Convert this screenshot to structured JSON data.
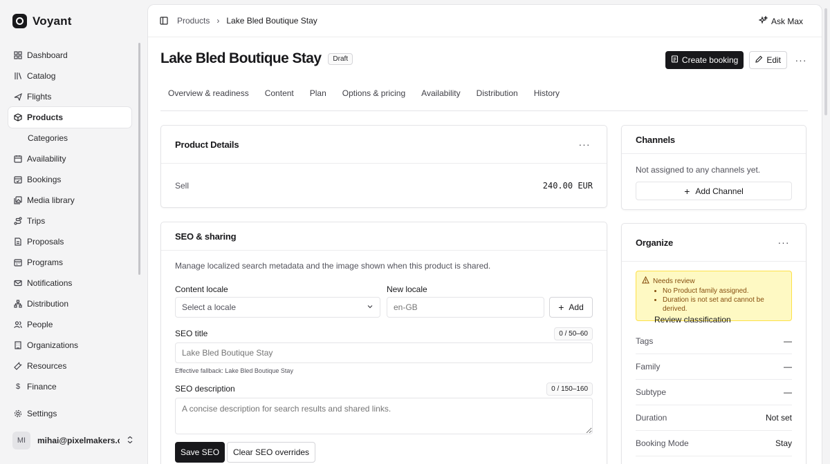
{
  "app": {
    "name": "Voyant"
  },
  "sidebar": {
    "items": [
      {
        "label": "Dashboard",
        "icon": "dashboard-icon"
      },
      {
        "label": "Catalog",
        "icon": "library-icon"
      },
      {
        "label": "Flights",
        "icon": "plane-icon"
      },
      {
        "label": "Products",
        "icon": "package-icon",
        "active": true
      },
      {
        "label": "Categories",
        "icon": "",
        "sub": true
      },
      {
        "label": "Availability",
        "icon": "calendar-icon"
      },
      {
        "label": "Bookings",
        "icon": "calendar-check-icon"
      },
      {
        "label": "Media library",
        "icon": "images-icon"
      },
      {
        "label": "Trips",
        "icon": "route-icon"
      },
      {
        "label": "Proposals",
        "icon": "file-icon"
      },
      {
        "label": "Programs",
        "icon": "calendar-grid-icon"
      },
      {
        "label": "Notifications",
        "icon": "mail-icon"
      },
      {
        "label": "Distribution",
        "icon": "network-icon"
      },
      {
        "label": "People",
        "icon": "users-icon"
      },
      {
        "label": "Organizations",
        "icon": "building-icon"
      },
      {
        "label": "Resources",
        "icon": "wrench-icon"
      },
      {
        "label": "Finance",
        "icon": "dollar-icon"
      }
    ],
    "settings_label": "Settings",
    "user": {
      "initials": "MI",
      "email": "mihai@pixelmakers.c..."
    }
  },
  "topbar": {
    "crumbs": [
      "Products",
      "Lake Bled Boutique Stay"
    ],
    "ask_label": "Ask Max"
  },
  "page": {
    "title": "Lake Bled Boutique Stay",
    "status": "Draft",
    "create_booking_label": "Create booking",
    "edit_label": "Edit",
    "more_label": "···"
  },
  "tabs": [
    "Overview & readiness",
    "Content",
    "Plan",
    "Options & pricing",
    "Availability",
    "Distribution",
    "History"
  ],
  "product_details": {
    "title": "Product Details",
    "sell_label": "Sell",
    "sell_value": "240.00 EUR"
  },
  "seo": {
    "title": "SEO & sharing",
    "description": "Manage localized search metadata and the image shown when this product is shared.",
    "content_locale_label": "Content locale",
    "content_locale_placeholder": "Select a locale",
    "new_locale_label": "New locale",
    "new_locale_placeholder": "en-GB",
    "add_label": "Add",
    "seo_title_label": "SEO title",
    "seo_title_counter": "0 / 50–60",
    "seo_title_placeholder": "Lake Bled Boutique Stay",
    "fallback_note": "Effective fallback: Lake Bled Boutique Stay",
    "seo_desc_label": "SEO description",
    "seo_desc_counter": "0 / 150–160",
    "seo_desc_placeholder": "A concise description for search results and shared links.",
    "save_label": "Save SEO",
    "clear_label": "Clear SEO overrides"
  },
  "channels": {
    "title": "Channels",
    "empty_text": "Not assigned to any channels yet.",
    "add_label": "Add Channel"
  },
  "organize": {
    "title": "Organize",
    "warning_title": "Needs review",
    "warnings": [
      "No Product family assigned.",
      "Duration is not set and cannot be derived."
    ],
    "review_link": "Review classification",
    "rows": [
      {
        "label": "Tags",
        "value": "—"
      },
      {
        "label": "Family",
        "value": "—"
      },
      {
        "label": "Subtype",
        "value": "—"
      },
      {
        "label": "Duration",
        "value": "Not set"
      },
      {
        "label": "Booking Mode",
        "value": "Stay"
      }
    ]
  }
}
